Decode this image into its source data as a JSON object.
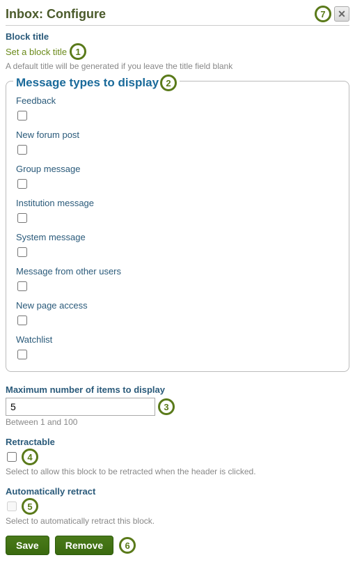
{
  "header": {
    "title": "Inbox: Configure"
  },
  "block_title": {
    "label": "Block title",
    "link": "Set a block title",
    "hint": "A default title will be generated if you leave the title field blank"
  },
  "fieldset": {
    "legend": "Message types to display",
    "items": [
      {
        "label": "Feedback"
      },
      {
        "label": "New forum post"
      },
      {
        "label": "Group message"
      },
      {
        "label": "Institution message"
      },
      {
        "label": "System message"
      },
      {
        "label": "Message from other users"
      },
      {
        "label": "New page access"
      },
      {
        "label": "Watchlist"
      }
    ]
  },
  "max_items": {
    "label": "Maximum number of items to display",
    "value": "5",
    "hint": "Between 1 and 100"
  },
  "retractable": {
    "label": "Retractable",
    "hint": "Select to allow this block to be retracted when the header is clicked."
  },
  "auto_retract": {
    "label": "Automatically retract",
    "hint": "Select to automatically retract this block."
  },
  "buttons": {
    "save": "Save",
    "remove": "Remove"
  },
  "annot": {
    "a1": "1",
    "a2": "2",
    "a3": "3",
    "a4": "4",
    "a5": "5",
    "a6": "6",
    "a7": "7"
  }
}
